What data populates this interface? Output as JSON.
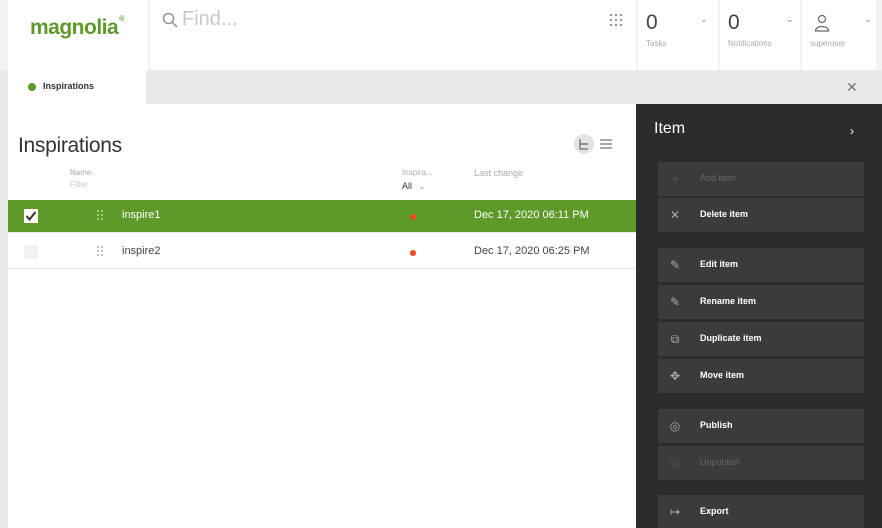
{
  "header": {
    "logo_text": "magnolia",
    "search": {
      "placeholder": "Find..."
    },
    "tasks": {
      "count": "0",
      "label": "Tasks"
    },
    "notifications": {
      "count": "0",
      "label": "Notifications"
    },
    "user": {
      "label": "superuser"
    }
  },
  "tab": {
    "label": "Inspirations",
    "accent": "#5d9a2a"
  },
  "content": {
    "title": "Inspirations",
    "columns": {
      "name": "Name",
      "filter_placeholder": "Filter",
      "inspira": "Inspira...",
      "inspira_filter": "All",
      "last_change": "Last change"
    },
    "rows": [
      {
        "name": "inspire1",
        "date": "Dec 17, 2020 06:11 PM",
        "selected": true,
        "status_color": "#f04a1c"
      },
      {
        "name": "inspire2",
        "date": "Dec 17, 2020 06:25 PM",
        "selected": false,
        "status_color": "#f04a1c"
      }
    ],
    "selection_color": "#5d9a2a"
  },
  "panel": {
    "title": "Item",
    "actions": [
      {
        "label": "Add item",
        "icon": "plus-icon",
        "enabled": false
      },
      {
        "label": "Delete item",
        "icon": "close-icon",
        "enabled": true
      },
      {
        "label": "Edit item",
        "icon": "pencil-icon",
        "enabled": true
      },
      {
        "label": "Rename item",
        "icon": "pencil-icon",
        "enabled": true
      },
      {
        "label": "Duplicate item",
        "icon": "duplicate-icon",
        "enabled": true
      },
      {
        "label": "Move item",
        "icon": "move-icon",
        "enabled": true
      },
      {
        "label": "Publish",
        "icon": "publish-icon",
        "enabled": true
      },
      {
        "label": "Unpublish",
        "icon": "unpublish-icon",
        "enabled": false
      },
      {
        "label": "Export",
        "icon": "export-icon",
        "enabled": true
      }
    ]
  }
}
